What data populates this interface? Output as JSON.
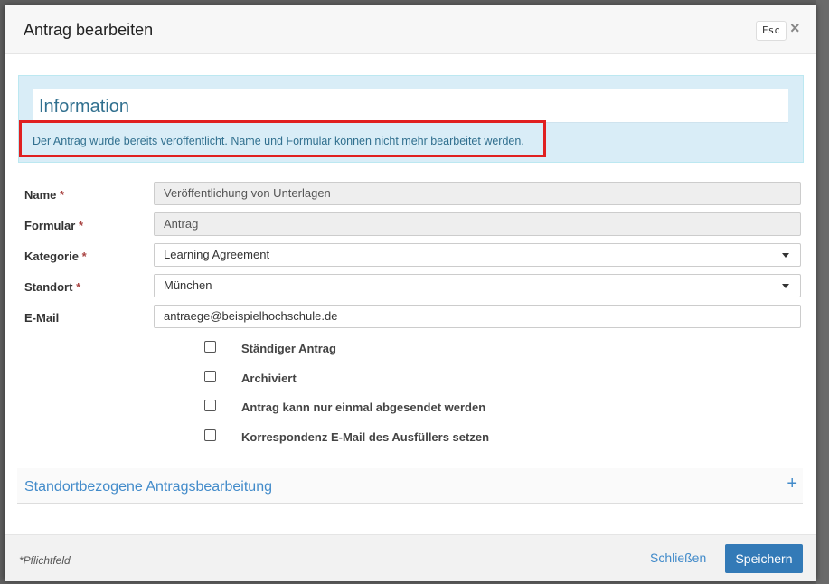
{
  "modal": {
    "title": "Antrag bearbeiten",
    "esc_label": "Esc",
    "close_label": "×"
  },
  "info": {
    "title": "Information",
    "text": "Der Antrag wurde bereits veröffentlicht. Name und Formular können nicht mehr bearbeitet werden."
  },
  "form": {
    "required_mark": "*",
    "fields": [
      {
        "label": "Name",
        "required": true,
        "value": "Veröffentlichung von Unterlagen",
        "disabled": true,
        "type": "text"
      },
      {
        "label": "Formular",
        "required": true,
        "value": "Antrag",
        "disabled": true,
        "type": "text"
      },
      {
        "label": "Kategorie",
        "required": true,
        "value": "Learning Agreement",
        "disabled": false,
        "type": "select"
      },
      {
        "label": "Standort",
        "required": true,
        "value": "München",
        "disabled": false,
        "type": "select"
      },
      {
        "label": "E-Mail",
        "required": false,
        "value": "antraege@beispielhochschule.de",
        "disabled": false,
        "type": "text"
      }
    ],
    "checkboxes": [
      {
        "label": "Ständiger Antrag",
        "checked": false
      },
      {
        "label": "Archiviert",
        "checked": false
      },
      {
        "label": "Antrag kann nur einmal abgesendet werden",
        "checked": false
      },
      {
        "label": "Korrespondenz E-Mail des Ausfüllers setzen",
        "checked": false
      }
    ]
  },
  "panel": {
    "title": "Standortbezogene Antragsbearbeitung",
    "toggle": "+"
  },
  "footer": {
    "note": "*Pflichtfeld",
    "close_label": "Schließen",
    "save_label": "Speichern"
  },
  "colors": {
    "primary": "#337ab7",
    "info_bg": "#d9edf7",
    "info_text": "#31708f",
    "highlight": "#e02020",
    "required": "#a94442"
  }
}
